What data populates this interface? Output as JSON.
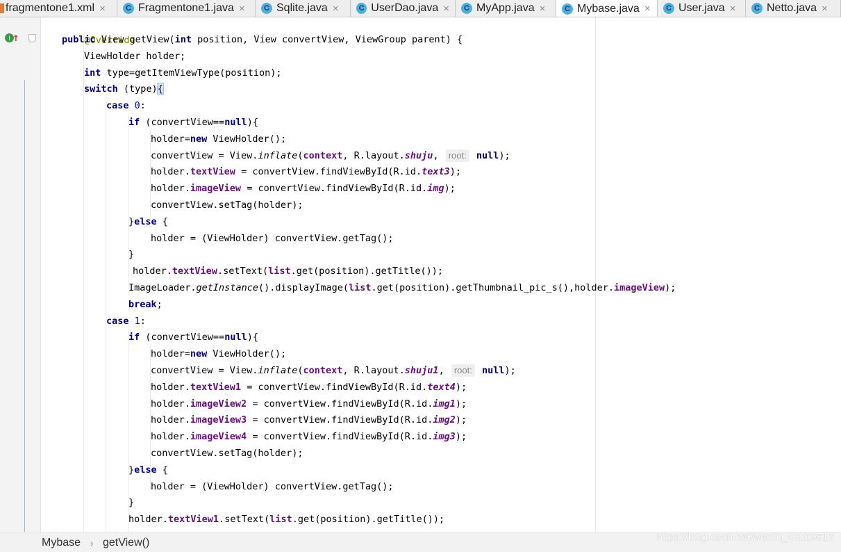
{
  "tabs": [
    {
      "label": "fragmentone1.xml",
      "icon": "xml-file-icon",
      "active": false
    },
    {
      "label": "Fragmentone1.java",
      "icon": "java-class-icon",
      "active": false
    },
    {
      "label": "Sqlite.java",
      "icon": "java-class-icon",
      "active": false
    },
    {
      "label": "UserDao.java",
      "icon": "java-class-icon",
      "active": false
    },
    {
      "label": "MyApp.java",
      "icon": "java-class-icon",
      "active": false
    },
    {
      "label": "Mybase.java",
      "icon": "java-class-icon",
      "active": true
    },
    {
      "label": "User.java",
      "icon": "java-class-icon",
      "active": false
    },
    {
      "label": "Netto.java",
      "icon": "java-class-icon",
      "active": false
    }
  ],
  "tab_icon_letter": "C",
  "tab_close_glyph": "×",
  "code": {
    "annotation": "@Override",
    "lines": [
      {
        "text": "public View getView(int position, View convertView, ViewGroup parent) {"
      },
      {
        "text": "ViewHolder holder;"
      },
      {
        "text": "int type=getItemViewType(position);"
      },
      {
        "text": "switch (type){"
      },
      {
        "text": "case 0:"
      },
      {
        "text": "if (convertView==null){"
      },
      {
        "text": "holder=new ViewHolder();"
      },
      {
        "text": "convertView = View.inflate(context, R.layout.shuju, root: null);"
      },
      {
        "text": "holder.textView = convertView.findViewById(R.id.text3);"
      },
      {
        "text": "holder.imageView = convertView.findViewById(R.id.img);"
      },
      {
        "text": "convertView.setTag(holder);"
      },
      {
        "text": "}else {"
      },
      {
        "text": "holder = (ViewHolder) convertView.getTag();"
      },
      {
        "text": "}"
      },
      {
        "text": "holder.textView.setText(list.get(position).getTitle());"
      },
      {
        "text": "ImageLoader.getInstance().displayImage(list.get(position).getThumbnail_pic_s(),holder.imageView);"
      },
      {
        "text": "break;"
      },
      {
        "text": "case 1:"
      },
      {
        "text": "if (convertView==null){"
      },
      {
        "text": "holder=new ViewHolder();"
      },
      {
        "text": "convertView = View.inflate(context, R.layout.shuju1, root: null);"
      },
      {
        "text": "holder.textView1 = convertView.findViewById(R.id.text4);"
      },
      {
        "text": "holder.imageView2 = convertView.findViewById(R.id.img1);"
      },
      {
        "text": "holder.imageView3 = convertView.findViewById(R.id.img2);"
      },
      {
        "text": "holder.imageView4 = convertView.findViewById(R.id.img3);"
      },
      {
        "text": "convertView.setTag(holder);"
      },
      {
        "text": "}else {"
      },
      {
        "text": "holder = (ViewHolder) convertView.getTag();"
      },
      {
        "text": "}"
      },
      {
        "text": "holder.textView1.setText(list.get(position).getTitle());"
      }
    ]
  },
  "breadcrumb": {
    "items": [
      "Mybase",
      "getView()"
    ],
    "separator": "›"
  },
  "watermark": "https://blog.csdn.net/weixin_43819517",
  "colors": {
    "keyword": "#000080",
    "field": "#660e7a",
    "number": "#0000ff",
    "annotation": "#808000",
    "active_tab": "#ffffff"
  }
}
